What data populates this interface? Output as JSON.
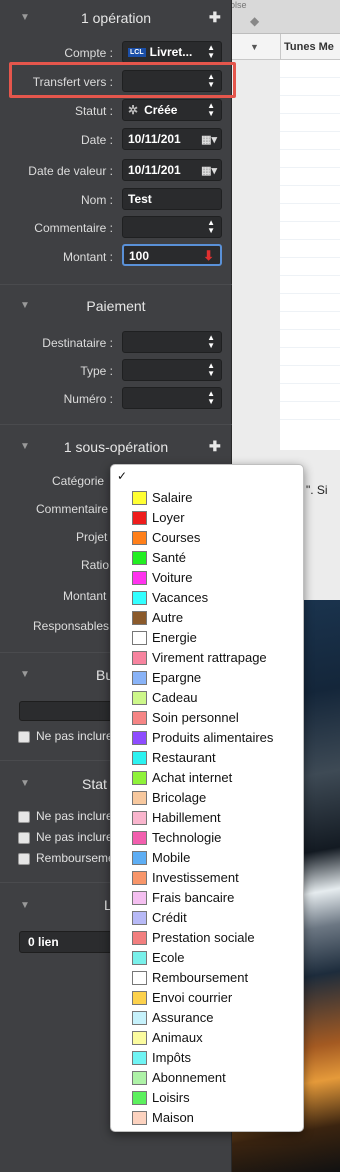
{
  "background_window": {
    "top_fragment": "olse",
    "column_fragment": "Tunes Me",
    "text_fragment": "D \". Si"
  },
  "operation": {
    "title": "1 opération",
    "fields": [
      {
        "label": "Compte :",
        "value": "Livret..."
      },
      {
        "label": "Transfert vers :",
        "value": ""
      },
      {
        "label": "Statut :",
        "value": "Créée"
      },
      {
        "label": "Date :",
        "value": "10/11/201"
      },
      {
        "label": "Date de valeur :",
        "value": "10/11/201"
      },
      {
        "label": "Nom :",
        "value": "Test"
      },
      {
        "label": "Commentaire :",
        "value": ""
      },
      {
        "label": "Montant :",
        "value": "100"
      }
    ]
  },
  "account_badge": "LCL",
  "paiement": {
    "title": "Paiement",
    "fields": [
      {
        "label": "Destinataire :",
        "value": ""
      },
      {
        "label": "Type :",
        "value": ""
      },
      {
        "label": "Numéro :",
        "value": ""
      }
    ]
  },
  "sous_operation": {
    "title": "1 sous-opération",
    "labels": [
      "Catégorie",
      "Commentaire",
      "Projet",
      "Ratio",
      "Montant",
      "Responsables"
    ]
  },
  "budget": {
    "title_fragment": "Bu",
    "checkbox": "Ne pas inclure"
  },
  "stats": {
    "title_fragment": "Stat",
    "checkboxes": [
      "Ne pas inclure",
      "Ne pas inclure",
      "Rembourseme"
    ]
  },
  "liens": {
    "title_fragment": "L",
    "value": "0 lien"
  },
  "category_menu": {
    "check": "✓",
    "items": [
      {
        "label": "Salaire",
        "color": "#ffff33"
      },
      {
        "label": "Loyer",
        "color": "#ee1c1c"
      },
      {
        "label": "Courses",
        "color": "#ff7f1a"
      },
      {
        "label": "Santé",
        "color": "#22ee22"
      },
      {
        "label": "Voiture",
        "color": "#ff33ee"
      },
      {
        "label": "Vacances",
        "color": "#33ffff"
      },
      {
        "label": "Autre",
        "color": "#8b5a2b"
      },
      {
        "label": "Energie",
        "color": "#ffffff"
      },
      {
        "label": "Virement rattrapage",
        "color": "#f7849f"
      },
      {
        "label": "Epargne",
        "color": "#89b3f7"
      },
      {
        "label": "Cadeau",
        "color": "#cdf78a"
      },
      {
        "label": "Soin personnel",
        "color": "#f58585"
      },
      {
        "label": "Produits alimentaires",
        "color": "#8e4cff"
      },
      {
        "label": "Restaurant",
        "color": "#2cf2f0"
      },
      {
        "label": "Achat internet",
        "color": "#8ff23a"
      },
      {
        "label": "Bricolage",
        "color": "#f7c89e"
      },
      {
        "label": "Habillement",
        "color": "#f9b5cd"
      },
      {
        "label": "Technologie",
        "color": "#f25fae"
      },
      {
        "label": "Mobile",
        "color": "#5eaef4"
      },
      {
        "label": "Investissement",
        "color": "#f8966a"
      },
      {
        "label": "Frais bancaire",
        "color": "#f4bff0"
      },
      {
        "label": "Crédit",
        "color": "#b7b9f6"
      },
      {
        "label": "Prestation sociale",
        "color": "#f27f7f"
      },
      {
        "label": "Ecole",
        "color": "#79f0ea"
      },
      {
        "label": "Remboursement",
        "color": "#ffffff"
      },
      {
        "label": "Envoi courrier",
        "color": "#fcd14c"
      },
      {
        "label": "Assurance",
        "color": "#c6f1fb"
      },
      {
        "label": "Animaux",
        "color": "#fbfb9f"
      },
      {
        "label": "Impôts",
        "color": "#70f4f4"
      },
      {
        "label": "Abonnement",
        "color": "#aef2a7"
      },
      {
        "label": "Loisirs",
        "color": "#5cf05e"
      },
      {
        "label": "Maison",
        "color": "#fcd2bf"
      }
    ]
  }
}
